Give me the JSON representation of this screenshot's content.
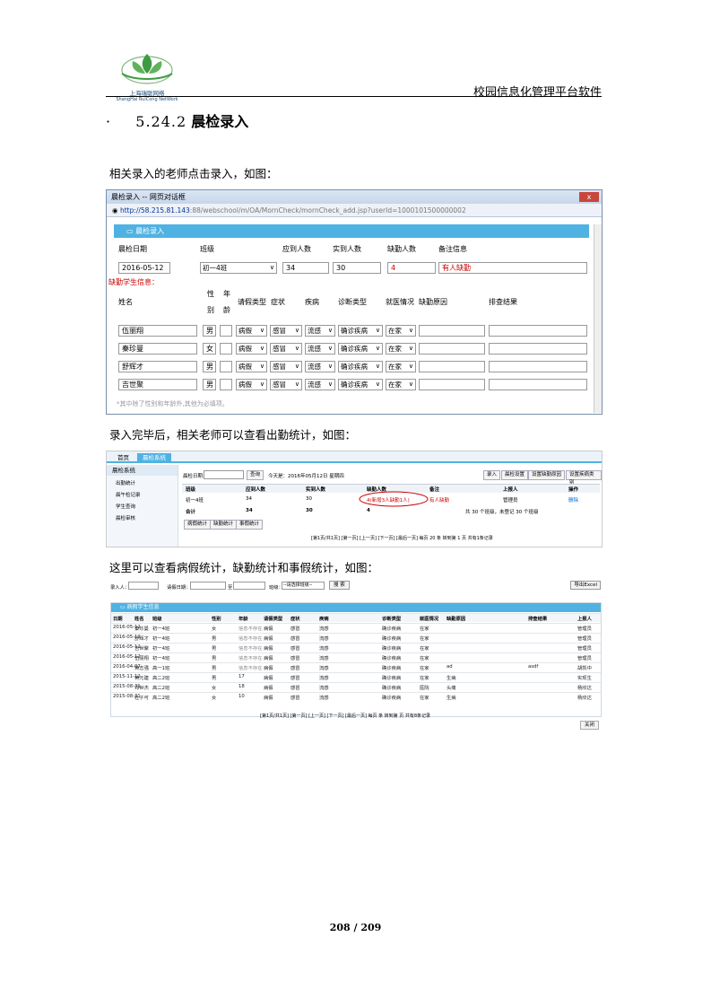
{
  "header": {
    "logo_cn": "上海瑞聪网络",
    "logo_en": "ShangHai RuiCong NetWork",
    "doc_title": "校园信息化管理平台软件"
  },
  "section": {
    "bullet": "·",
    "number": "5.24.2",
    "title": "晨检录入"
  },
  "paragraphs": {
    "p1": "相关录入的老师点击录入，如图：",
    "p2": "录入完毕后，相关老师可以查看出勤统计，如图：",
    "p3": "这里可以查看病假统计，缺勤统计和事假统计，如图："
  },
  "shot1": {
    "window_title": "晨检录入 -- 网页对话框",
    "close": "x",
    "url_ip": "http://58.215.81.143",
    "url_rest": ":88/webschool/m/OA/MornCheck/mornCheck_add.jsp?userId=1000101500000002",
    "panel_title": "晨检录入",
    "labels": {
      "date": "晨检日期",
      "class": "班级",
      "expected": "应到人数",
      "actual": "实到人数",
      "absent": "缺勤人数",
      "remark": "备注信息"
    },
    "values": {
      "date": "2016-05-12",
      "class": "初一4班",
      "expected": "34",
      "actual": "30",
      "absent": "4",
      "remark": "有人缺勤"
    },
    "absent_info": "缺勤学生信息：",
    "cols": {
      "name": "姓名",
      "sex1": "性",
      "sex2": "别",
      "age1": "年",
      "age2": "龄",
      "leave": "请假类型",
      "symptom": "症状",
      "disease": "疾病",
      "diag": "诊断类型",
      "visit": "就医情况",
      "reason": "缺勤原因",
      "result": "排查结果"
    },
    "rows": [
      {
        "name": "伍丽翔",
        "sex": "男",
        "leave": "病假",
        "symptom": "感冒",
        "disease": "流感",
        "diag": "确诊疾病",
        "visit": "在家"
      },
      {
        "name": "秦珍曼",
        "sex": "女",
        "leave": "病假",
        "symptom": "感冒",
        "disease": "流感",
        "diag": "确诊疾病",
        "visit": "在家"
      },
      {
        "name": "舒辉才",
        "sex": "男",
        "leave": "病假",
        "symptom": "感冒",
        "disease": "流感",
        "diag": "确诊疾病",
        "visit": "在家"
      },
      {
        "name": "吉世聚",
        "sex": "男",
        "leave": "病假",
        "symptom": "感冒",
        "disease": "流感",
        "diag": "确诊疾病",
        "visit": "在家"
      }
    ],
    "note": "*其中除了性别和年龄外,其他为必填项。"
  },
  "shot2": {
    "tab_home": "首页",
    "tab_active": "晨检系统",
    "side_title": "晨检系统",
    "side_items": [
      "出勤统计",
      "晨午检记录",
      "学生查询",
      "晨检审核"
    ],
    "date_label": "晨检日期:",
    "query_btn": "查询",
    "today": "今天是：2016年05月12日 星期四",
    "top_btns": [
      "录入",
      "晨检设置",
      "设置缺勤原因",
      "设置疾病类别"
    ],
    "cols": [
      "班级",
      "应到人数",
      "实到人数",
      "缺勤人数",
      "备注",
      "上报人",
      "操作"
    ],
    "row1": [
      "初一4班",
      "34",
      "30",
      "4(新增3人缺勤1人)",
      "有人缺勤",
      "管理员",
      "删除"
    ],
    "row2": [
      "合计",
      "34",
      "30",
      "4",
      "共 30 个班级，未登记 30 个班级"
    ],
    "bottom_btns": [
      "病假统计",
      "缺勤统计",
      "事假统计"
    ],
    "pager": "[第1页/共1页] [第一页] [上一页] [下一页] [最后一页] 每页 20 条 转到第 1 页 共有1条记录"
  },
  "shot3": {
    "search_labels": [
      "录入人：",
      "请假日期：",
      "至",
      "班级："
    ],
    "class_select": "--请选择班级--",
    "search_btn": "搜 索",
    "export_btn": "导出Excel",
    "grid_title": "病假学生信息",
    "cols": [
      "日期",
      "姓名",
      "班级",
      "性别",
      "年龄",
      "请假类型",
      "症状",
      "疾病",
      "诊断类型",
      "就医情况",
      "缺勤原因",
      "排查结果",
      "上报人"
    ],
    "rows": [
      [
        "2016-05-12",
        "秦珍曼",
        "初一4班",
        "女",
        "信息不存在",
        "病假",
        "感冒",
        "流感",
        "确诊疾病",
        "在家",
        "",
        "",
        "管理员"
      ],
      [
        "2016-05-12",
        "舒辉才",
        "初一4班",
        "男",
        "信息不存在",
        "病假",
        "感冒",
        "流感",
        "确诊疾病",
        "在家",
        "",
        "",
        "管理员"
      ],
      [
        "2016-05-12",
        "吉世聚",
        "初一4班",
        "男",
        "信息不存在",
        "病假",
        "感冒",
        "流感",
        "确诊疾病",
        "在家",
        "",
        "",
        "管理员"
      ],
      [
        "2016-05-12",
        "伍丽翔",
        "初一4班",
        "男",
        "信息不存在",
        "病假",
        "感冒",
        "流感",
        "确诊疾病",
        "在家",
        "",
        "",
        "管理员"
      ],
      [
        "2016-04-07",
        "蒋志强",
        "高一1班",
        "男",
        "信息不存在",
        "病假",
        "感冒",
        "流感",
        "确诊疾病",
        "在家",
        "ad",
        "asdf",
        "胡凯中"
      ],
      [
        "2015-11-12",
        "蒋元建",
        "高二2班",
        "男",
        "17",
        "病假",
        "感冒",
        "流感",
        "确诊疾病",
        "在家",
        "生病",
        "",
        "实现生"
      ],
      [
        "2015-08-31",
        "邓世杰",
        "高二2班",
        "女",
        "18",
        "病假",
        "感冒",
        "流感",
        "确诊疾病",
        "医院",
        "头痛",
        "",
        "杨欣达"
      ],
      [
        "2015-08-31",
        "杜子可",
        "高二2班",
        "女",
        "10",
        "病假",
        "感冒",
        "流感",
        "确诊疾病",
        "在家",
        "生病",
        "",
        "杨欣达"
      ]
    ],
    "pager": "[第1页/共1页] [第一页] [上一页] [下一页] [最后一页] 每页 条 转到第 页 共有8条记录",
    "close_btn": "关闭"
  },
  "footer": {
    "page": "208 / 209"
  },
  "colors": {
    "accent": "#4fb2e3",
    "red": "#cc0000"
  }
}
